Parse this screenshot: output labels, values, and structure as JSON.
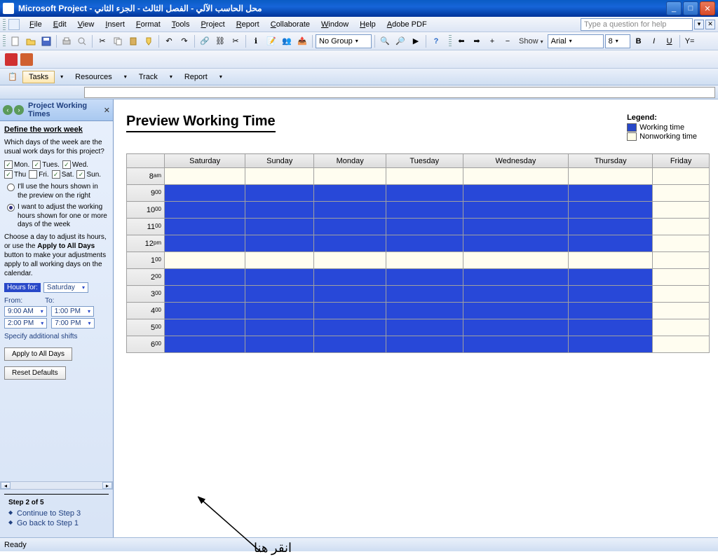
{
  "titlebar": {
    "app": "Microsoft Project",
    "doc": "محل الحاسب الآلي - الفصل الثالث - الجزء الثاني"
  },
  "menu": [
    "File",
    "Edit",
    "View",
    "Insert",
    "Format",
    "Tools",
    "Project",
    "Report",
    "Collaborate",
    "Window",
    "Help",
    "Adobe PDF"
  ],
  "help_placeholder": "Type a question for help",
  "toolbar": {
    "group_label": "No Group",
    "show_label": "Show",
    "font_name": "Arial",
    "font_size": "8"
  },
  "guide": {
    "tasks": "Tasks",
    "resources": "Resources",
    "track": "Track",
    "report": "Report"
  },
  "sidepane": {
    "title": "Project Working Times",
    "section": "Define the work week",
    "question": "Which days of the week are the usual work days for this project?",
    "days": [
      {
        "label": "Mon.",
        "checked": true
      },
      {
        "label": "Tues.",
        "checked": true
      },
      {
        "label": "Wed.",
        "checked": true
      },
      {
        "label": "Thu",
        "checked": true
      },
      {
        "label": "Fri.",
        "checked": false
      },
      {
        "label": "Sat.",
        "checked": true
      },
      {
        "label": "Sun.",
        "checked": true
      }
    ],
    "radio1": "I'll use the hours shown in the preview on the right",
    "radio2": "I want to adjust the working hours shown for one or more days of the week",
    "radio_selected": 2,
    "instructions": "Choose a day to adjust its hours, or use the Apply to All Days button to make your adjustments apply to all working days on the calendar.",
    "hours_for_label": "Hours for:",
    "hours_for_value": "Saturday",
    "from_label": "From:",
    "to_label": "To:",
    "from1": "9:00 AM",
    "to1": "1:00 PM",
    "from2": "2:00 PM",
    "to2": "7:00 PM",
    "specify_shifts": "Specify additional shifts",
    "apply_all": "Apply to All Days",
    "reset": "Reset Defaults",
    "step": "Step 2 of 5",
    "continue": "Continue to Step 3",
    "goback": "Go back to Step 1",
    "instructions_bold": "Apply to All Days"
  },
  "preview": {
    "title": "Preview Working Time",
    "legend_title": "Legend:",
    "legend_work": "Working time",
    "legend_nonwork": "Nonworking time",
    "days": [
      "Saturday",
      "Sunday",
      "Monday",
      "Tuesday",
      "Wednesday",
      "Thursday",
      "Friday"
    ],
    "hours": [
      {
        "h": "8",
        "sup": "am"
      },
      {
        "h": "9",
        "sup": "00"
      },
      {
        "h": "10",
        "sup": "00"
      },
      {
        "h": "11",
        "sup": "00"
      },
      {
        "h": "12",
        "sup": "pm"
      },
      {
        "h": "1",
        "sup": "00"
      },
      {
        "h": "2",
        "sup": "00"
      },
      {
        "h": "3",
        "sup": "00"
      },
      {
        "h": "4",
        "sup": "00"
      },
      {
        "h": "5",
        "sup": "00"
      },
      {
        "h": "6",
        "sup": "00"
      }
    ],
    "nonwork_day_index": 6,
    "nonwork_hour_indices": [
      0,
      5
    ]
  },
  "annotation": "انقر هنا",
  "status": "Ready"
}
